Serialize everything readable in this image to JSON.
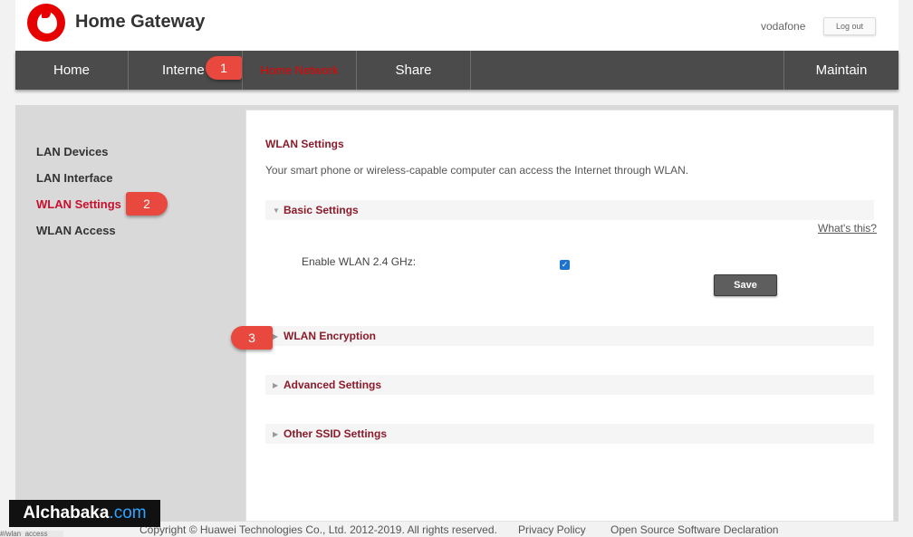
{
  "header": {
    "title": "Home Gateway",
    "user": "vodafone",
    "logout_label": "Log out"
  },
  "nav": {
    "items": [
      {
        "label": "Home"
      },
      {
        "label": "Interne"
      },
      {
        "label": "Home Network"
      },
      {
        "label": "Share"
      },
      {
        "label": "Maintain"
      }
    ]
  },
  "sidebar": {
    "items": [
      {
        "label": "LAN Devices"
      },
      {
        "label": "LAN Interface"
      },
      {
        "label": "WLAN Settings"
      },
      {
        "label": "WLAN Access"
      }
    ]
  },
  "panel": {
    "title": "WLAN Settings",
    "description": "Your smart phone or wireless-capable computer can access the Internet through WLAN.",
    "sections": {
      "basic": "Basic Settings",
      "encryption": "WLAN Encryption",
      "advanced": "Advanced Settings",
      "other_ssid": "Other SSID Settings"
    },
    "whats_this": "What's this?",
    "enable_label": "Enable WLAN 2.4 GHz:",
    "enable_checked": true,
    "save_label": "Save"
  },
  "callouts": {
    "one": "1",
    "two": "2",
    "three": "3"
  },
  "footer": {
    "copyright": "Copyright © Huawei Technologies Co., Ltd. 2012-2019. All rights reserved.",
    "privacy": "Privacy Policy",
    "open_source": "Open Source Software Declaration"
  },
  "watermark": {
    "brand": "Alchabaka",
    "tld": ".com"
  },
  "status_bar": {
    "url": "#/wlan_access"
  },
  "colors": {
    "brand_red": "#e60000",
    "nav_bg": "#4b4b4b",
    "section_text": "#8b1b2b",
    "callout": "#e8483e"
  }
}
